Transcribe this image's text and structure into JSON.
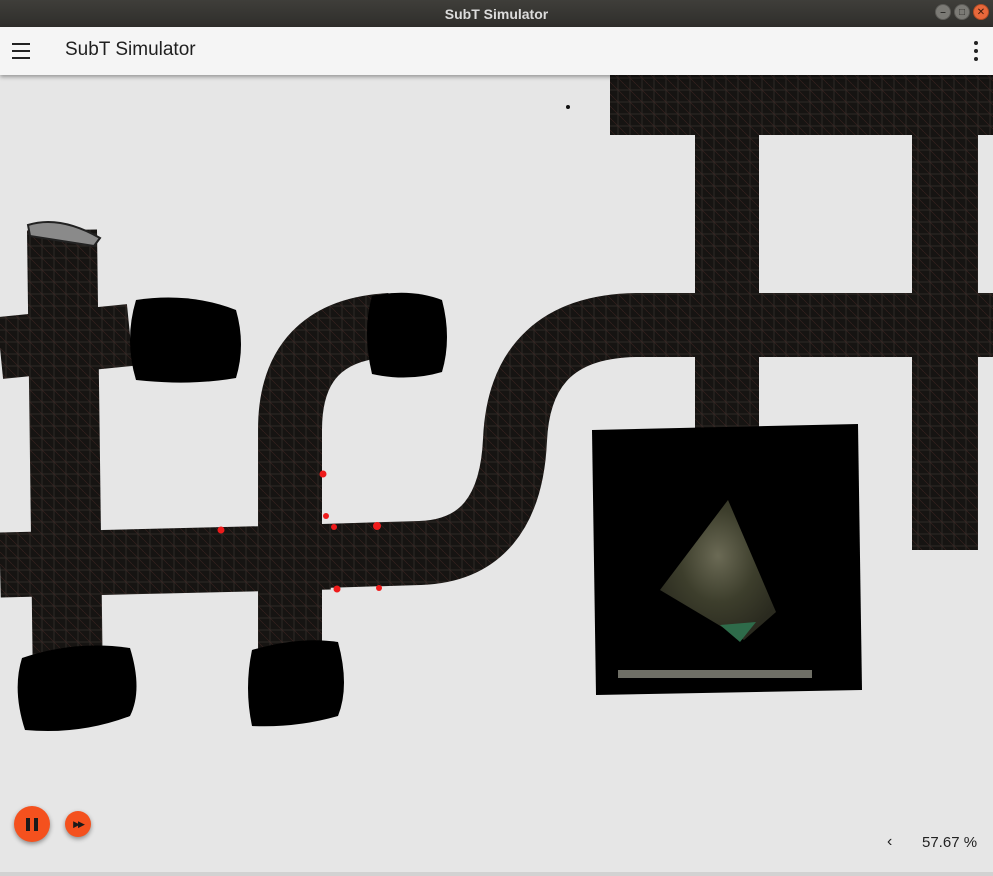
{
  "window": {
    "title": "SubT Simulator",
    "controls": [
      "minimize-icon",
      "maximize-icon",
      "close-icon"
    ]
  },
  "appbar": {
    "title": "SubT Simulator",
    "menu_icon": "hamburger-menu-icon",
    "more_icon": "more-vert-icon"
  },
  "scene": {
    "description_icon": "3d-tunnel-scene",
    "colors": {
      "background": "#e6e6e6",
      "tunnel": "#141210",
      "accent": "#f4511e"
    }
  },
  "controls": {
    "pause_icon": "pause-icon",
    "fast_forward_icon": "fast-forward-icon",
    "rtf_chevron": "‹",
    "rtf_value": "57.67 %"
  }
}
